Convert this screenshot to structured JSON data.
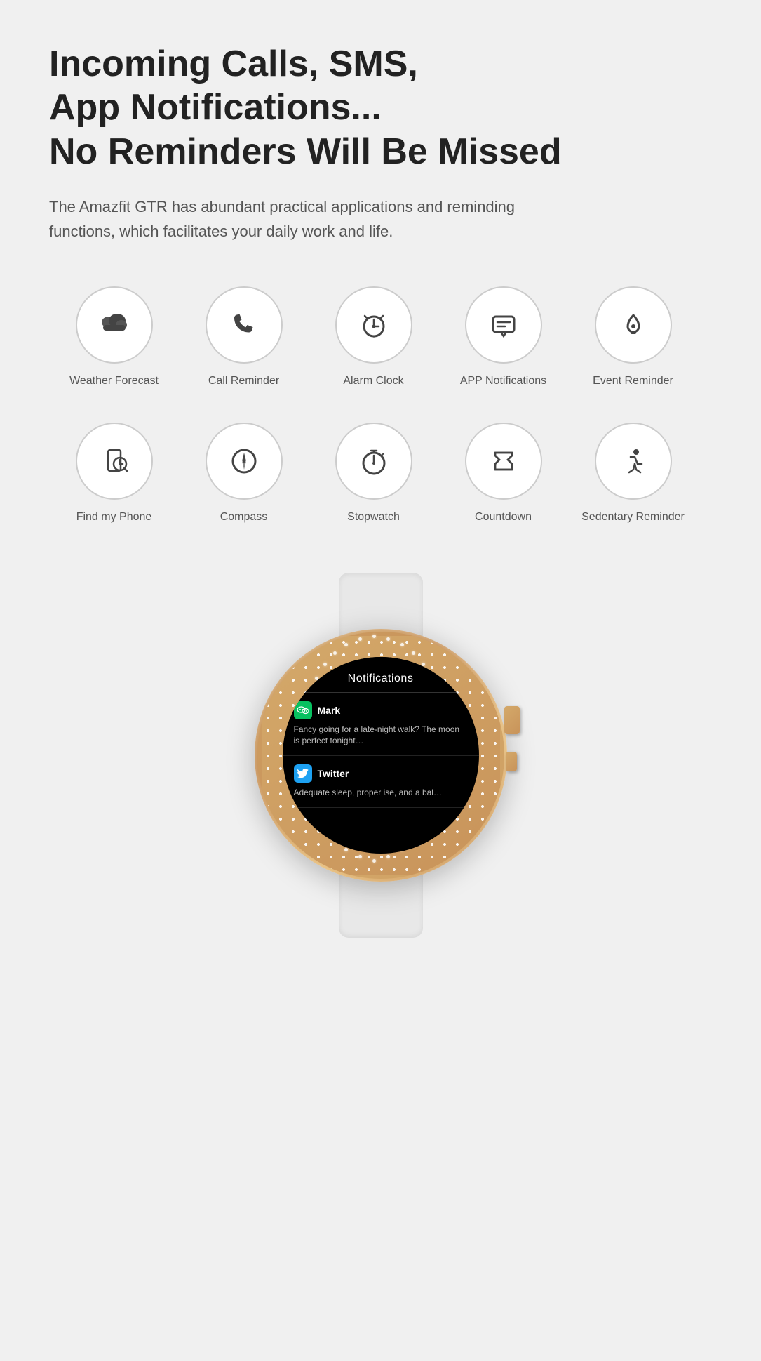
{
  "headline": {
    "line1": "Incoming Calls, SMS,",
    "line2": "App Notifications...",
    "line3": "No Reminders Will Be Missed"
  },
  "description": "The Amazfit GTR has abundant practical applications and reminding functions, which facilitates your daily work and life.",
  "features_row1": [
    {
      "id": "weather-forecast",
      "label": "Weather Forecast",
      "icon": "🌤"
    },
    {
      "id": "call-reminder",
      "label": "Call Reminder",
      "icon": "📞"
    },
    {
      "id": "alarm-clock",
      "label": "Alarm Clock",
      "icon": "⏰"
    },
    {
      "id": "app-notifications",
      "label": "APP Notifications",
      "icon": "💬"
    },
    {
      "id": "event-reminder",
      "label": "Event Reminder",
      "icon": "🔔"
    }
  ],
  "features_row2": [
    {
      "id": "find-my-phone",
      "label": "Find my Phone",
      "icon": "🔍"
    },
    {
      "id": "compass",
      "label": "Compass",
      "icon": "🧭"
    },
    {
      "id": "stopwatch",
      "label": "Stopwatch",
      "icon": "⏱"
    },
    {
      "id": "countdown",
      "label": "Countdown",
      "icon": "⏳"
    },
    {
      "id": "sedentary-reminder",
      "label": "Sedentary Reminder",
      "icon": "🧍"
    }
  ],
  "watch": {
    "screen_title": "Notifications",
    "notifications": [
      {
        "app": "WeChat",
        "sender": "Mark",
        "message": "Fancy going for a late-night walk? The moon is perfect tonight…"
      },
      {
        "app": "Twitter",
        "sender": "Twitter",
        "message": "Adequate sleep, proper ise, and a bal…"
      }
    ]
  }
}
